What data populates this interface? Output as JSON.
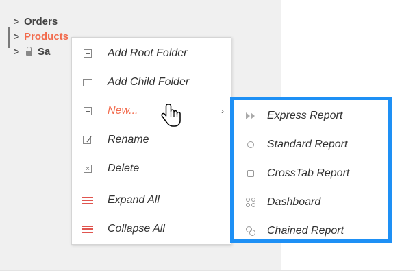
{
  "tree": {
    "items": [
      {
        "label": "Orders"
      },
      {
        "label": "Products"
      },
      {
        "label": "Sa"
      }
    ]
  },
  "context_menu": {
    "items": [
      {
        "label": "Add Root Folder",
        "icon": "add-folder-icon"
      },
      {
        "label": "Add Child Folder",
        "icon": "folder-icon"
      },
      {
        "label": "New...",
        "icon": "plus-icon"
      },
      {
        "label": "Rename",
        "icon": "rename-icon"
      },
      {
        "label": "Delete",
        "icon": "delete-icon"
      },
      {
        "label": "Expand All",
        "icon": "expand-all-icon"
      },
      {
        "label": "Collapse All",
        "icon": "collapse-all-icon"
      }
    ]
  },
  "submenu": {
    "items": [
      {
        "label": "Express Report",
        "icon": "fast-forward-icon"
      },
      {
        "label": "Standard Report",
        "icon": "circle-icon"
      },
      {
        "label": "CrossTab Report",
        "icon": "square-icon"
      },
      {
        "label": "Dashboard",
        "icon": "dashboard-icon"
      },
      {
        "label": "Chained Report",
        "icon": "chain-icon"
      }
    ]
  },
  "colors": {
    "accent_red": "#f26b4d",
    "highlight_blue": "#1e90f5",
    "panel_bg": "#f0f0f0"
  }
}
